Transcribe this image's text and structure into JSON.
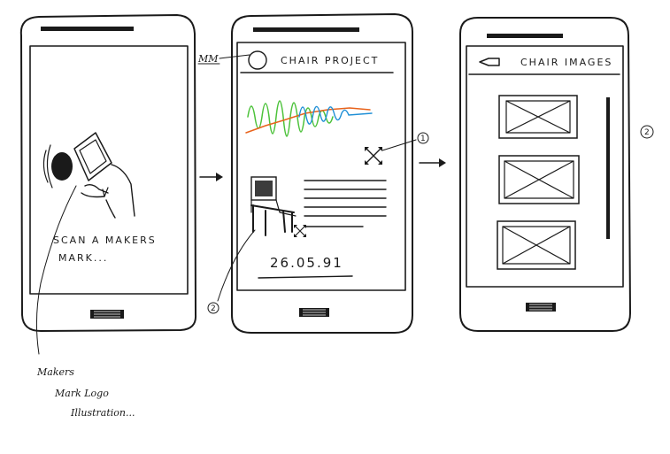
{
  "screen1": {
    "caption_line1": "SCAN A MAKERS",
    "caption_line2": "MARK..."
  },
  "screen2": {
    "logo_label": "MM",
    "title": "CHAIR PROJECT",
    "date": "26.05.91",
    "callout_1": "1",
    "callout_2": "2"
  },
  "screen3": {
    "title": "CHAIR IMAGES",
    "callout_2": "2"
  },
  "note": {
    "line1": "Makers",
    "line2": "Mark Logo",
    "line3": "Illustration..."
  },
  "colors": {
    "ink": "#1a1a1a",
    "wave_green": "#4cc23a",
    "wave_orange": "#e8631c",
    "wave_blue": "#1f8fd6"
  }
}
